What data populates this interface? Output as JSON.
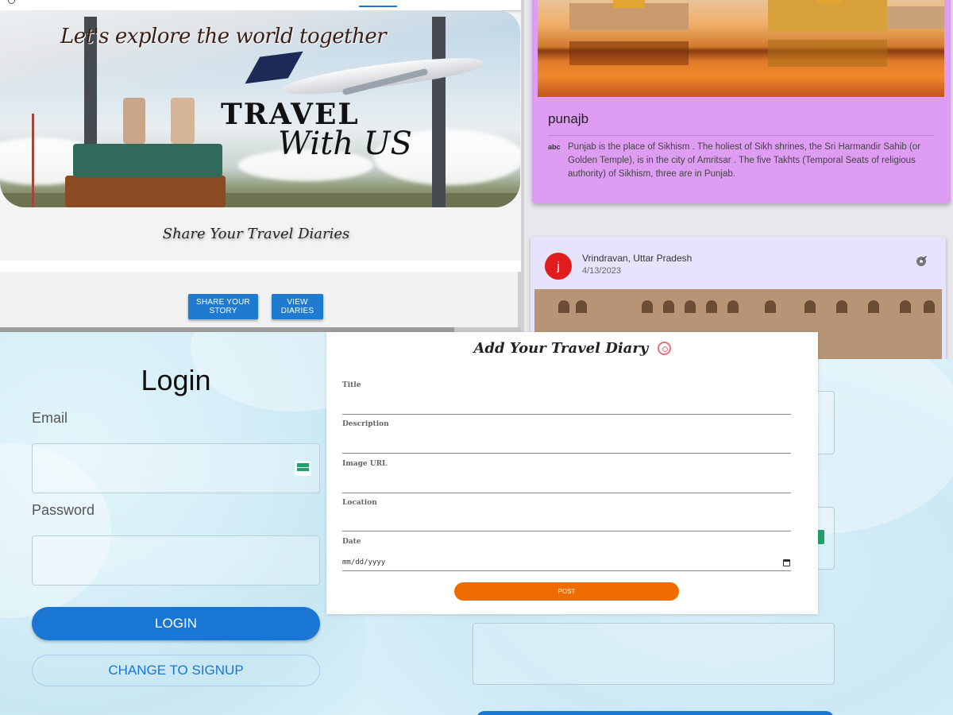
{
  "home": {
    "hero_tagline": "Let's explore the world together",
    "hero_title": "TRAVEL",
    "hero_subtitle": "With US",
    "share_heading": "Share Your Travel Diaries",
    "share_button": "SHARE YOUR STORY",
    "view_button": "VIEW DIARIES"
  },
  "diaries": {
    "cards": [
      {
        "title": "punajb",
        "description": "Punjab is the place of Sikhism . The holiest of Sikh shrines, the Sri Harmandir Sahib (or Golden Temple), is in the city of Amritsar . The five Takhts (Temporal Seats of religious authority) of Sikhism, three are in Punjab.",
        "desc_icon": "abc"
      },
      {
        "avatar": "j",
        "location": "Vrindravan, Uttar Pradesh",
        "date": "4/13/2023"
      }
    ],
    "card_color": "#de9df2",
    "card2_color": "#e6e3fc"
  },
  "login": {
    "title": "Login",
    "email_label": "Email",
    "password_label": "Password",
    "login_button": "LOGIN",
    "signup_button": "CHANGE TO SIGNUP"
  },
  "form": {
    "title": "Add Your Travel Diary",
    "fields": [
      "Title",
      "Description",
      "Image URL",
      "Location",
      "Date"
    ],
    "date_placeholder": "mm/dd/yyyy",
    "post_button": "POST",
    "post_color": "#ef6c00"
  },
  "colors": {
    "accent": "#1976d2",
    "avatar": "#e01c1c"
  }
}
